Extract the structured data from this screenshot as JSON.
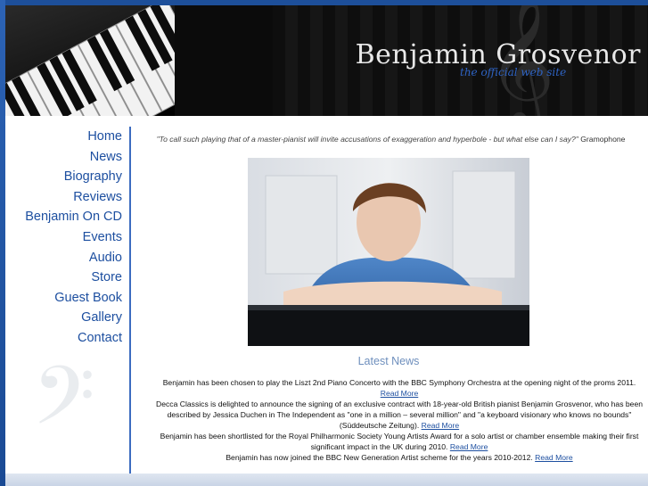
{
  "header": {
    "title": "Benjamin Grosvenor",
    "tagline": "the official web site"
  },
  "nav": {
    "items": [
      {
        "label": "Home"
      },
      {
        "label": "News"
      },
      {
        "label": "Biography"
      },
      {
        "label": "Reviews"
      },
      {
        "label": "Benjamin On CD"
      },
      {
        "label": "Events"
      },
      {
        "label": "Audio"
      },
      {
        "label": "Store"
      },
      {
        "label": "Guest Book"
      },
      {
        "label": "Gallery"
      },
      {
        "label": "Contact"
      }
    ]
  },
  "quote": {
    "text": "\"To call such playing that of a master-pianist will invite accusations of exaggeration and hyperbole - but what else can I say?\"",
    "source": "Gramophone"
  },
  "news": {
    "title": "Latest News",
    "items": [
      {
        "text": "Benjamin has been chosen to play the Liszt 2nd Piano Concerto with the BBC Symphony Orchestra at the opening night of the proms 2011.",
        "link": "Read More"
      },
      {
        "text": "Decca Classics is delighted to announce the signing of an exclusive contract with 18-year-old British pianist Benjamin Grosvenor, who has been described by Jessica Duchen in The Independent as \"one in a million – several million\" and \"a keyboard visionary who knows no bounds\" (Süddeutsche Zeitung).",
        "link": "Read More"
      },
      {
        "text": "Benjamin has been shortlisted for the Royal Philharmonic Society Young Artists Award for a solo artist or chamber ensemble making their first significant impact in the UK during 2010.",
        "link": "Read More"
      },
      {
        "text": "Benjamin has now joined the BBC New Generation Artist scheme for the years 2010-2012.",
        "link": "Read More"
      }
    ]
  },
  "icons": {
    "treble_clef": "𝄞",
    "bass_clef": "𝄢"
  },
  "colors": {
    "nav_link": "#1d4fa0",
    "frame_blue": "#1d4f9a",
    "tagline": "#2e63c4",
    "news_title": "#6e8fbd"
  }
}
